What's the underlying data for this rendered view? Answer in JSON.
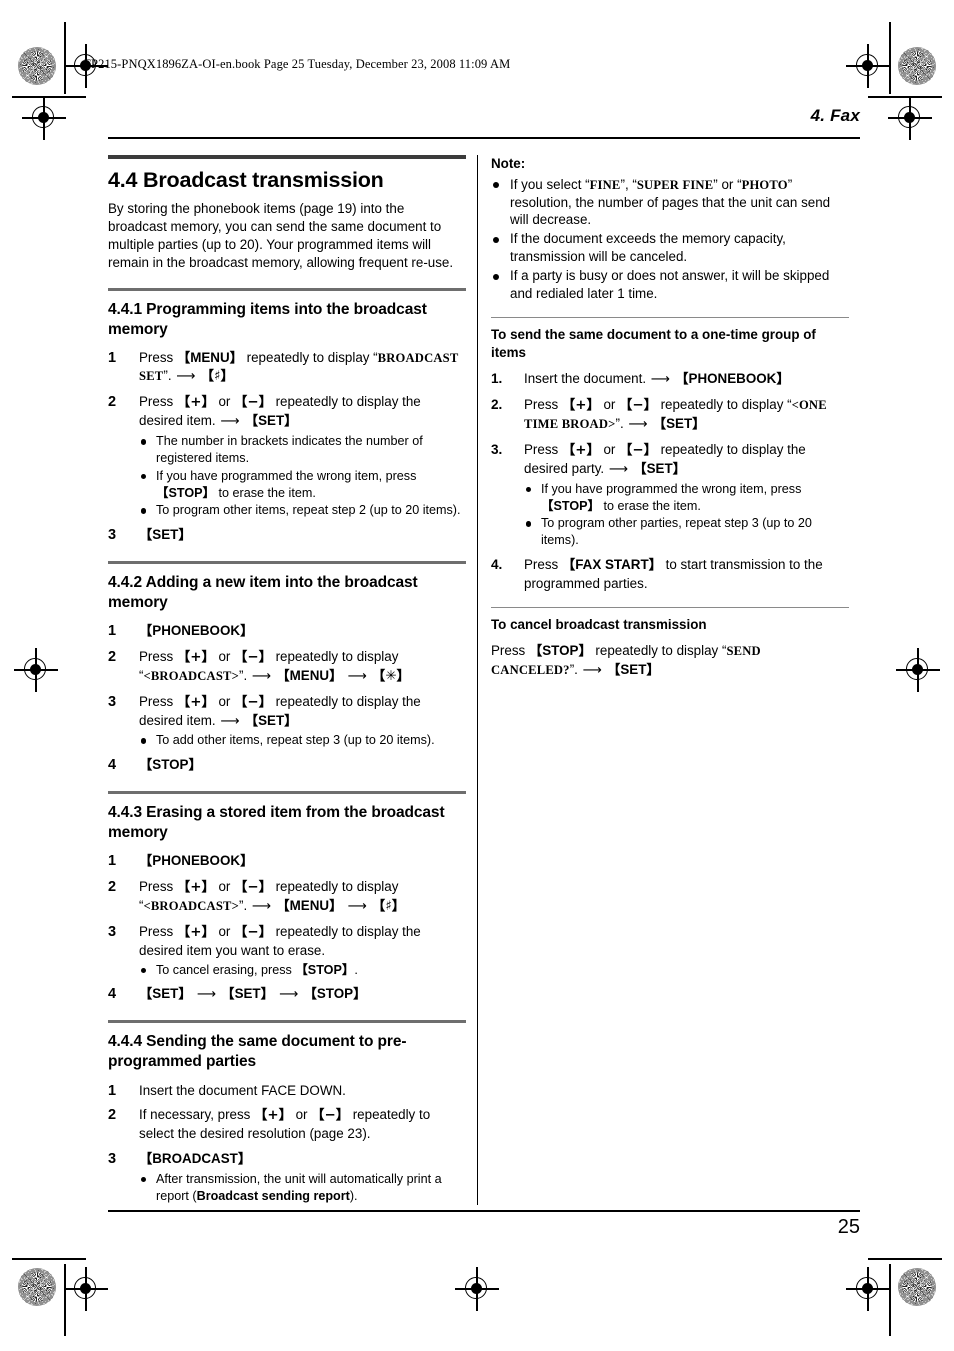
{
  "print_header": "FP215-PNQX1896ZA-OI-en.book  Page 25  Tuesday, December 23, 2008  11:09 AM",
  "chapter": "4. Fax",
  "page_number": "25",
  "left_column": {
    "section": {
      "title": "4.4 Broadcast transmission",
      "intro": "By storing the phonebook items (page 19) into the broadcast memory, you can send the same document to multiple parties (up to 20). Your programmed items will remain in the broadcast memory, allowing frequent re-use."
    },
    "sub_441": {
      "title": "4.4.1 Programming items into the broadcast memory",
      "steps": [
        {
          "num": "1",
          "parts": [
            {
              "t": "text",
              "v": "Press "
            },
            {
              "t": "key",
              "v": "MENU"
            },
            {
              "t": "text",
              "v": " repeatedly to display “"
            },
            {
              "t": "lcd",
              "v": "BROADCAST SET"
            },
            {
              "t": "text",
              "v": "”. "
            },
            {
              "t": "arrow"
            },
            {
              "t": "key",
              "v": "♯"
            }
          ]
        },
        {
          "num": "2",
          "parts": [
            {
              "t": "text",
              "v": "Press "
            },
            {
              "t": "key",
              "v": "+"
            },
            {
              "t": "text",
              "v": " or "
            },
            {
              "t": "key",
              "v": "−"
            },
            {
              "t": "text",
              "v": " repeatedly to display the desired item. "
            },
            {
              "t": "arrow"
            },
            {
              "t": "key",
              "v": "SET"
            }
          ],
          "bullets": [
            [
              {
                "t": "text",
                "v": "The number in brackets indicates the number of registered items."
              }
            ],
            [
              {
                "t": "text",
                "v": "If you have programmed the wrong item, press "
              },
              {
                "t": "key",
                "v": "STOP"
              },
              {
                "t": "text",
                "v": " to erase the item."
              }
            ],
            [
              {
                "t": "text",
                "v": "To program other items, repeat step 2 (up to 20 items)."
              }
            ]
          ]
        },
        {
          "num": "3",
          "parts": [
            {
              "t": "key",
              "v": "SET"
            }
          ]
        }
      ]
    },
    "sub_442": {
      "title": "4.4.2 Adding a new item into the broadcast memory",
      "steps": [
        {
          "num": "1",
          "parts": [
            {
              "t": "key",
              "v": "PHONEBOOK"
            }
          ]
        },
        {
          "num": "2",
          "parts": [
            {
              "t": "text",
              "v": "Press "
            },
            {
              "t": "key",
              "v": "+"
            },
            {
              "t": "text",
              "v": " or "
            },
            {
              "t": "key",
              "v": "−"
            },
            {
              "t": "text",
              "v": " repeatedly to display “"
            },
            {
              "t": "lcd",
              "v": "<BROADCAST>"
            },
            {
              "t": "text",
              "v": "”. "
            },
            {
              "t": "arrow"
            },
            {
              "t": "key",
              "v": "MENU"
            },
            {
              "t": "arrow"
            },
            {
              "t": "key",
              "v": "✳"
            }
          ]
        },
        {
          "num": "3",
          "parts": [
            {
              "t": "text",
              "v": "Press "
            },
            {
              "t": "key",
              "v": "+"
            },
            {
              "t": "text",
              "v": " or "
            },
            {
              "t": "key",
              "v": "−"
            },
            {
              "t": "text",
              "v": " repeatedly to display the desired item. "
            },
            {
              "t": "arrow"
            },
            {
              "t": "key",
              "v": "SET"
            }
          ],
          "bullets": [
            [
              {
                "t": "text",
                "v": "To add other items, repeat step 3 (up to 20 items)."
              }
            ]
          ]
        },
        {
          "num": "4",
          "parts": [
            {
              "t": "key",
              "v": "STOP"
            }
          ]
        }
      ]
    },
    "sub_443": {
      "title": "4.4.3 Erasing a stored item from the broadcast memory",
      "steps": [
        {
          "num": "1",
          "parts": [
            {
              "t": "key",
              "v": "PHONEBOOK"
            }
          ]
        },
        {
          "num": "2",
          "parts": [
            {
              "t": "text",
              "v": "Press "
            },
            {
              "t": "key",
              "v": "+"
            },
            {
              "t": "text",
              "v": " or "
            },
            {
              "t": "key",
              "v": "−"
            },
            {
              "t": "text",
              "v": " repeatedly to display “"
            },
            {
              "t": "lcd",
              "v": "<BROADCAST>"
            },
            {
              "t": "text",
              "v": "”. "
            },
            {
              "t": "arrow"
            },
            {
              "t": "key",
              "v": "MENU"
            },
            {
              "t": "arrow"
            },
            {
              "t": "key",
              "v": "♯"
            }
          ]
        },
        {
          "num": "3",
          "parts": [
            {
              "t": "text",
              "v": "Press "
            },
            {
              "t": "key",
              "v": "+"
            },
            {
              "t": "text",
              "v": " or "
            },
            {
              "t": "key",
              "v": "−"
            },
            {
              "t": "text",
              "v": " repeatedly to display the desired item you want to erase."
            }
          ],
          "bullets": [
            [
              {
                "t": "text",
                "v": "To cancel erasing, press "
              },
              {
                "t": "key",
                "v": "STOP"
              },
              {
                "t": "text",
                "v": "."
              }
            ]
          ]
        },
        {
          "num": "4",
          "parts": [
            {
              "t": "key",
              "v": "SET"
            },
            {
              "t": "arrow"
            },
            {
              "t": "key",
              "v": "SET"
            },
            {
              "t": "arrow"
            },
            {
              "t": "key",
              "v": "STOP"
            }
          ]
        }
      ]
    },
    "sub_444": {
      "title": "4.4.4 Sending the same document to pre-programmed parties",
      "steps": [
        {
          "num": "1",
          "parts": [
            {
              "t": "text",
              "v": "Insert the document FACE DOWN."
            }
          ]
        },
        {
          "num": "2",
          "parts": [
            {
              "t": "text",
              "v": "If necessary, press "
            },
            {
              "t": "key",
              "v": "+"
            },
            {
              "t": "text",
              "v": " or "
            },
            {
              "t": "key",
              "v": "−"
            },
            {
              "t": "text",
              "v": " repeatedly to select the desired resolution (page 23)."
            }
          ]
        },
        {
          "num": "3",
          "parts": [
            {
              "t": "key",
              "v": "BROADCAST"
            }
          ],
          "bullets": [
            [
              {
                "t": "text",
                "v": "After transmission, the unit will automatically print a report ("
              },
              {
                "t": "bold",
                "v": "Broadcast sending report"
              },
              {
                "t": "text",
                "v": ")."
              }
            ]
          ]
        }
      ]
    }
  },
  "right_column": {
    "note": {
      "label": "Note:",
      "bullets": [
        [
          {
            "t": "text",
            "v": "If you select “"
          },
          {
            "t": "lcd",
            "v": "FINE"
          },
          {
            "t": "text",
            "v": "”, “"
          },
          {
            "t": "lcd",
            "v": "SUPER FINE"
          },
          {
            "t": "text",
            "v": "” or “"
          },
          {
            "t": "lcd",
            "v": "PHOTO"
          },
          {
            "t": "text",
            "v": "” resolution, the number of pages that the unit can send will decrease."
          }
        ],
        [
          {
            "t": "text",
            "v": "If the document exceeds the memory capacity, transmission will be canceled."
          }
        ],
        [
          {
            "t": "text",
            "v": "If a party is busy or does not answer, it will be skipped and redialed later 1 time."
          }
        ]
      ]
    },
    "one_time_group": {
      "title": "To send the same document to a one-time group of items",
      "steps": [
        {
          "num": "1.",
          "parts": [
            {
              "t": "text",
              "v": "Insert the document. "
            },
            {
              "t": "arrow"
            },
            {
              "t": "key",
              "v": "PHONEBOOK"
            }
          ]
        },
        {
          "num": "2.",
          "parts": [
            {
              "t": "text",
              "v": "Press "
            },
            {
              "t": "key",
              "v": "+"
            },
            {
              "t": "text",
              "v": " or "
            },
            {
              "t": "key",
              "v": "−"
            },
            {
              "t": "text",
              "v": " repeatedly to display “"
            },
            {
              "t": "lcd",
              "v": "<ONE TIME BROAD>"
            },
            {
              "t": "text",
              "v": "”. "
            },
            {
              "t": "arrow"
            },
            {
              "t": "key",
              "v": "SET"
            }
          ]
        },
        {
          "num": "3.",
          "parts": [
            {
              "t": "text",
              "v": "Press "
            },
            {
              "t": "key",
              "v": "+"
            },
            {
              "t": "text",
              "v": " or "
            },
            {
              "t": "key",
              "v": "−"
            },
            {
              "t": "text",
              "v": " repeatedly to display the desired party. "
            },
            {
              "t": "arrow"
            },
            {
              "t": "key",
              "v": "SET"
            }
          ],
          "bullets": [
            [
              {
                "t": "text",
                "v": "If you have programmed the wrong item, press "
              },
              {
                "t": "key",
                "v": "STOP"
              },
              {
                "t": "text",
                "v": " to erase the item."
              }
            ],
            [
              {
                "t": "text",
                "v": "To program other parties, repeat step 3 (up to 20 items)."
              }
            ]
          ]
        },
        {
          "num": "4.",
          "parts": [
            {
              "t": "text",
              "v": "Press "
            },
            {
              "t": "key",
              "v": "FAX START"
            },
            {
              "t": "text",
              "v": " to start transmission to the programmed parties."
            }
          ]
        }
      ]
    },
    "cancel": {
      "title": "To cancel broadcast transmission",
      "body": [
        {
          "t": "text",
          "v": "Press "
        },
        {
          "t": "key",
          "v": "STOP"
        },
        {
          "t": "text",
          "v": " repeatedly to display “"
        },
        {
          "t": "lcd",
          "v": "SEND CANCELED?"
        },
        {
          "t": "text",
          "v": "”. "
        },
        {
          "t": "arrow"
        },
        {
          "t": "key",
          "v": "SET"
        }
      ]
    }
  }
}
